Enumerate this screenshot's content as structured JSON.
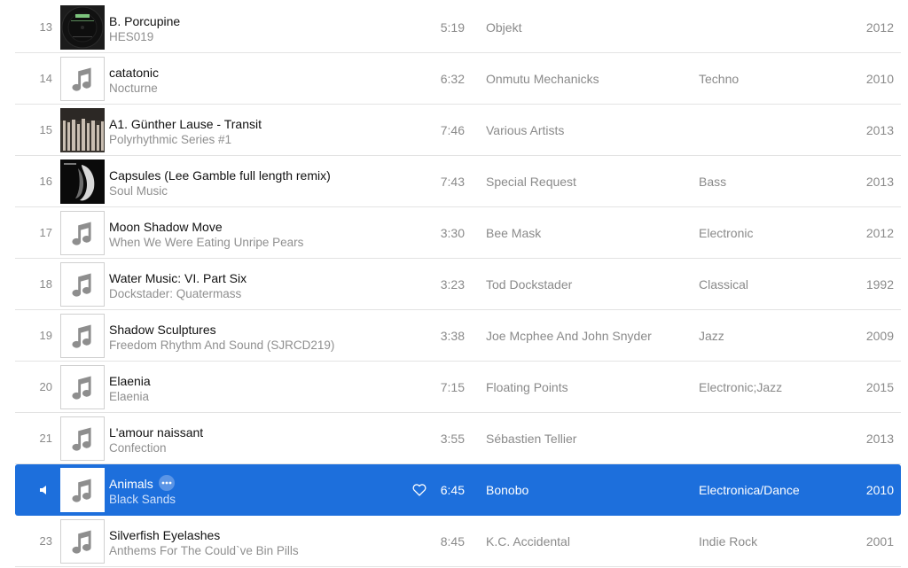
{
  "colors": {
    "selection": "#1d6fdc",
    "secondary_text": "#8a8a8a",
    "divider": "#e3e3e3"
  },
  "tracks": [
    {
      "num": "13",
      "title": "B. Porcupine",
      "album": "HES019",
      "time": "5:19",
      "artist": "Objekt",
      "genre": "",
      "year": "2012",
      "art": "objekt-cover"
    },
    {
      "num": "14",
      "title": "catatonic",
      "album": "Nocturne",
      "time": "6:32",
      "artist": "Onmutu Mechanicks",
      "genre": "Techno",
      "year": "2010",
      "art": "music-note-icon"
    },
    {
      "num": "15",
      "title": "A1. Günther Lause - Transit",
      "album": "Polyrhythmic Series #1",
      "time": "7:46",
      "artist": "Various Artists",
      "genre": "",
      "year": "2013",
      "art": "polyrhythmic-cover"
    },
    {
      "num": "16",
      "title": "Capsules (Lee Gamble full length remix)",
      "album": "Soul Music",
      "time": "7:43",
      "artist": "Special Request",
      "genre": "Bass",
      "year": "2013",
      "art": "soul-music-cover"
    },
    {
      "num": "17",
      "title": "Moon Shadow Move",
      "album": "When We Were Eating Unripe Pears",
      "time": "3:30",
      "artist": "Bee Mask",
      "genre": "Electronic",
      "year": "2012",
      "art": "music-note-icon"
    },
    {
      "num": "18",
      "title": "Water Music: VI. Part Six",
      "album": "Dockstader: Quatermass",
      "time": "3:23",
      "artist": "Tod Dockstader",
      "genre": "Classical",
      "year": "1992",
      "art": "music-note-icon"
    },
    {
      "num": "19",
      "title": "Shadow Sculptures",
      "album": "Freedom Rhythm And Sound (SJRCD219)",
      "time": "3:38",
      "artist": "Joe Mcphee And John Snyder",
      "genre": "Jazz",
      "year": "2009",
      "art": "music-note-icon"
    },
    {
      "num": "20",
      "title": "Elaenia",
      "album": "Elaenia",
      "time": "7:15",
      "artist": "Floating Points",
      "genre": "Electronic;Jazz",
      "year": "2015",
      "art": "music-note-icon"
    },
    {
      "num": "21",
      "title": "L'amour naissant",
      "album": "Confection",
      "time": "3:55",
      "artist": "Sébastien Tellier",
      "genre": "",
      "year": "2013",
      "art": "music-note-icon"
    },
    {
      "num": "",
      "title": "Animals",
      "album": "Black Sands",
      "time": "6:45",
      "artist": "Bonobo",
      "genre": "Electronica/Dance",
      "year": "2010",
      "art": "music-note-icon",
      "selected": true,
      "playing": true
    },
    {
      "num": "23",
      "title": "Silverfish Eyelashes",
      "album": "Anthems For The Could`ve Bin Pills",
      "time": "8:45",
      "artist": "K.C. Accidental",
      "genre": "Indie Rock",
      "year": "2001",
      "art": "music-note-icon"
    }
  ]
}
